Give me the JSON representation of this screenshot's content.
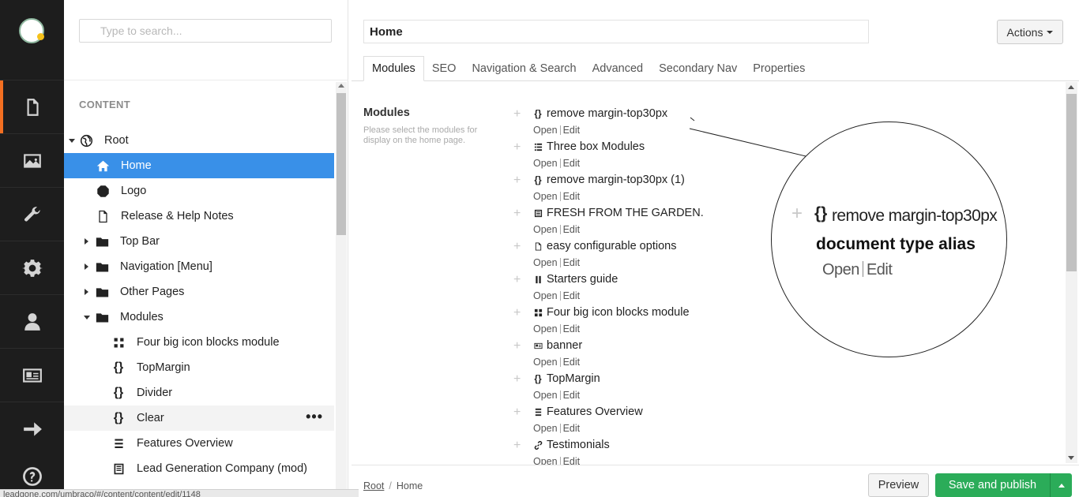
{
  "rail": {
    "sections": [
      {
        "icon": "content-icon",
        "active": true
      },
      {
        "icon": "media-icon"
      },
      {
        "icon": "wrench-icon"
      },
      {
        "icon": "gear-icon"
      },
      {
        "icon": "user-icon"
      },
      {
        "icon": "member-card-icon"
      },
      {
        "icon": "arrow-right-icon"
      },
      {
        "icon": "help-icon"
      }
    ]
  },
  "tree": {
    "search_placeholder": "Type to search...",
    "heading": "CONTENT",
    "nodes": [
      {
        "label": "Root",
        "icon": "globe-icon"
      },
      {
        "label": "Home",
        "icon": "home-icon",
        "selected": true
      },
      {
        "label": "Logo",
        "icon": "octagon-icon"
      },
      {
        "label": "Release & Help Notes",
        "icon": "document-icon"
      },
      {
        "label": "Top Bar",
        "icon": "folder-icon"
      },
      {
        "label": "Navigation [Menu]",
        "icon": "folder-icon"
      },
      {
        "label": "Other Pages",
        "icon": "folder-icon"
      },
      {
        "label": "Modules",
        "icon": "folder-icon"
      },
      {
        "label": "Four big icon blocks module",
        "icon": "grid-icon"
      },
      {
        "label": "TopMargin",
        "icon": "braces-icon"
      },
      {
        "label": "Divider",
        "icon": "braces-icon"
      },
      {
        "label": "Clear",
        "icon": "braces-icon",
        "more": "•••"
      },
      {
        "label": "Features Overview",
        "icon": "list-icon"
      },
      {
        "label": "Lead Generation Company (mod)",
        "icon": "newspaper-icon"
      }
    ]
  },
  "status_bar": "leadgone.com/umbraco/#/content/content/edit/1148",
  "editor": {
    "name": "Home",
    "actions_label": "Actions",
    "tabs": [
      "Modules",
      "SEO",
      "Navigation & Search",
      "Advanced",
      "Secondary Nav",
      "Properties"
    ],
    "property": {
      "label": "Modules",
      "description": "Please select the modules for display on the home page."
    },
    "open_label": "Open",
    "edit_label": "Edit",
    "modules": [
      {
        "name": "remove margin-top30px",
        "icon": "braces-icon"
      },
      {
        "name": "Three box Modules",
        "icon": "list-icon"
      },
      {
        "name": "remove margin-top30px (1)",
        "icon": "braces-icon"
      },
      {
        "name": "FRESH FROM THE GARDEN.",
        "icon": "newspaper-icon"
      },
      {
        "name": "easy configurable options",
        "icon": "document-icon"
      },
      {
        "name": "Starters guide",
        "icon": "pause-icon"
      },
      {
        "name": "Four big icon blocks module",
        "icon": "grid-icon"
      },
      {
        "name": "banner",
        "icon": "id-card-icon"
      },
      {
        "name": "TopMargin",
        "icon": "braces-icon"
      },
      {
        "name": "Features Overview",
        "icon": "list-icon"
      },
      {
        "name": "Testimonials",
        "icon": "link-icon"
      }
    ]
  },
  "callout": {
    "module_name": "remove margin-top30px",
    "alias": "document type alias",
    "open_label": "Open",
    "edit_label": "Edit"
  },
  "footer": {
    "breadcrumb": [
      "Root",
      "Home"
    ],
    "preview_label": "Preview",
    "publish_label": "Save and publish"
  },
  "colors": {
    "rail": "#1d1d1d",
    "active_section": "#f36f21",
    "selected_node": "#3990e8",
    "publish": "#2bac59"
  }
}
